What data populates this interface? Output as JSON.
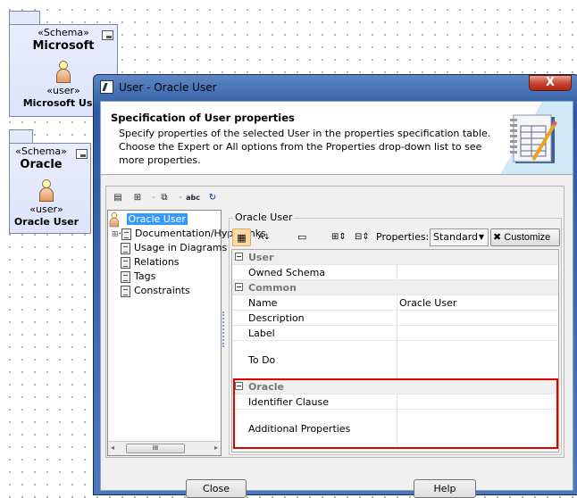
{
  "diagram": {
    "packages": [
      {
        "stereotype": "«Schema»",
        "name": "Microsoft",
        "user_stereotype": "«user»",
        "user_name": "Microsoft User"
      },
      {
        "stereotype": "«Schema»",
        "name": "Oracle",
        "user_stereotype": "«user»",
        "user_name": "Oracle User"
      }
    ]
  },
  "dialog": {
    "title": "User - Oracle User",
    "close_glyph": "X",
    "header_title": "Specification of User properties",
    "header_desc": "Specify properties of the selected User in the properties specification table. Choose the Expert or All options from the Properties drop-down list to see more properties.",
    "toolbar_abc": "abc",
    "tree": {
      "root": "Oracle User",
      "items": [
        "Documentation/Hyperlinks",
        "Usage in Diagrams",
        "Relations",
        "Tags",
        "Constraints"
      ],
      "scroll_grip": "III"
    },
    "group_label": "Oracle User",
    "properties_label": "Properties:",
    "properties_value": "Standard",
    "customize_label": "Customize",
    "table": {
      "groups": [
        {
          "name": "User",
          "rows": [
            {
              "key": "Owned Schema",
              "value": ""
            }
          ]
        },
        {
          "name": "Common",
          "rows": [
            {
              "key": "Name",
              "value": "Oracle User"
            },
            {
              "key": "Description",
              "value": ""
            },
            {
              "key": "Label",
              "value": ""
            },
            {
              "key": "To Do",
              "value": ""
            }
          ]
        },
        {
          "name": "Oracle",
          "rows": [
            {
              "key": "Identifier Clause",
              "value": ""
            },
            {
              "key": "Additional Properties",
              "value": ""
            }
          ]
        }
      ]
    },
    "close_button": "Close",
    "help_button": "Help"
  }
}
